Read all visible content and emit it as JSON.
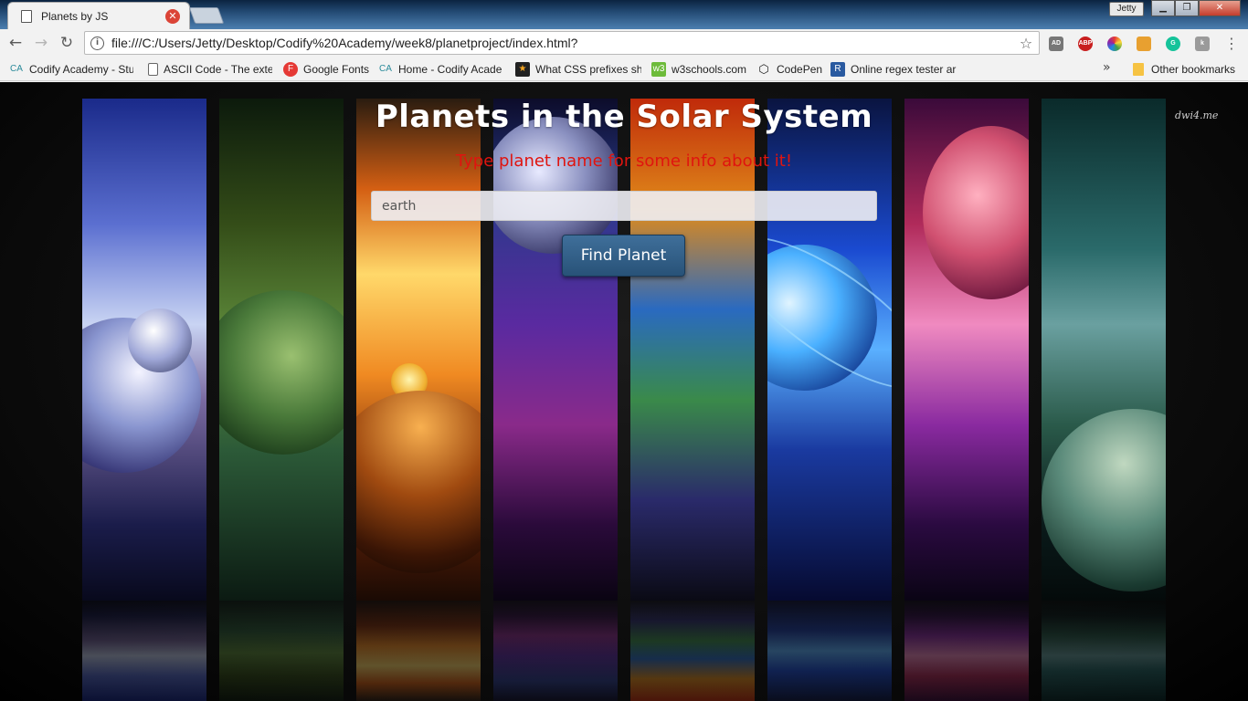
{
  "browser": {
    "tab_title": "Planets by JS",
    "url": "file:///C:/Users/Jetty/Desktop/Codify%20Academy/week8/planetproject/index.html?",
    "user_badge": "Jetty",
    "extensions": [
      "ad-block-icon",
      "abp-icon",
      "color-wheel-icon",
      "ruler-icon",
      "grammarly-icon",
      "extension-k-icon"
    ],
    "extension_labels": {
      "abp": "ABP",
      "grammarly": "G",
      "k": "k",
      "adblock": "AD"
    }
  },
  "bookmarks": {
    "items": [
      {
        "label": "Codify Academy - Stu",
        "icon": "CA"
      },
      {
        "label": "ASCII Code - The exte",
        "icon": "doc"
      },
      {
        "label": "Google Fonts",
        "icon": "F"
      },
      {
        "label": "Home - Codify Acade",
        "icon": "CA"
      },
      {
        "label": "What CSS prefixes sho",
        "icon": "★"
      },
      {
        "label": "w3schools.com",
        "icon": "w3"
      },
      {
        "label": "CodePen",
        "icon": "⬡"
      },
      {
        "label": "Online regex tester ar",
        "icon": "R"
      }
    ],
    "more": "»",
    "other": "Other bookmarks"
  },
  "page": {
    "watermark": "dwi4.me",
    "heading": "Planets in the Solar System",
    "subheading": "Type planet name for some info about it!",
    "search": {
      "value": "earth",
      "placeholder": ""
    },
    "find_button": "Find Planet"
  },
  "colors": {
    "subheading": "#e0140f",
    "button": "#285278",
    "page_background": "#0a0a0a"
  }
}
